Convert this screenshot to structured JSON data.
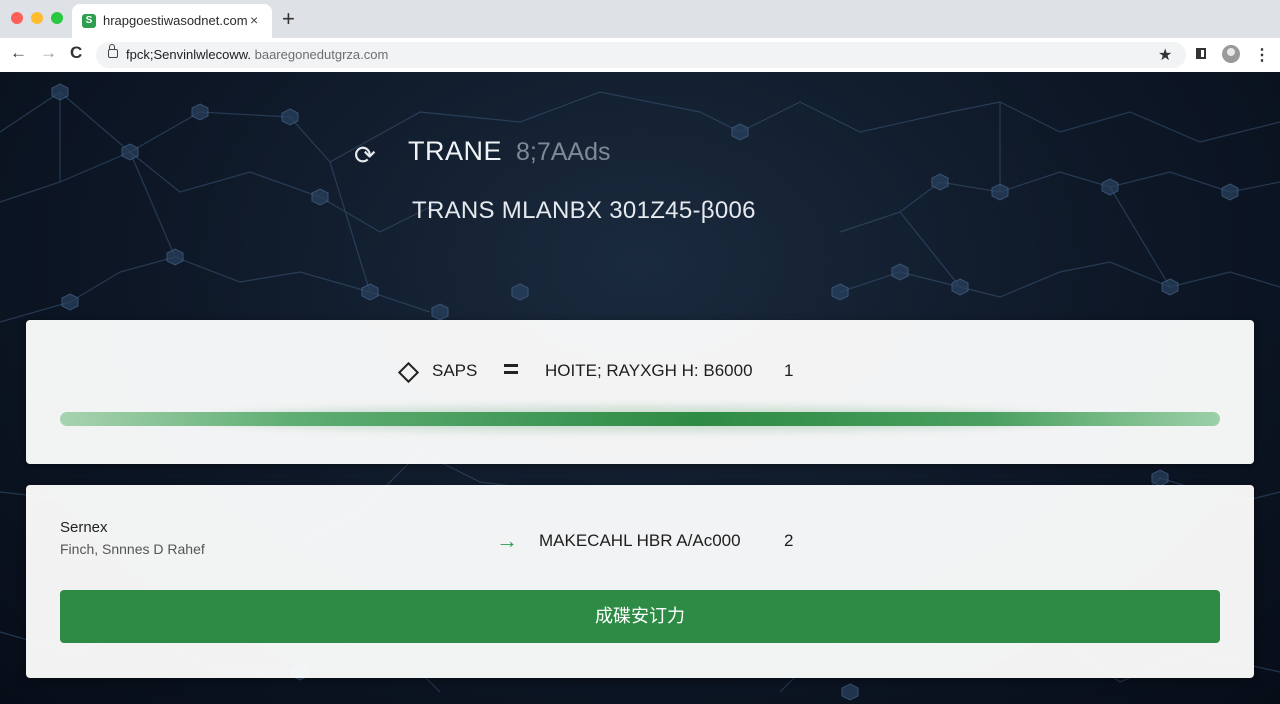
{
  "browser": {
    "tab_title": "hrapgoestiwasodnet.com",
    "tab_close": "×",
    "new_tab": "+",
    "url_host": "fpck;Senvinlwlecoww.",
    "url_rest": " baaregonedutgrza.com",
    "back": "←",
    "forward": "→",
    "reload": "C",
    "bookmark": "★",
    "menu": "⋮"
  },
  "hero": {
    "title": "TRANE",
    "title_faded": "8;7AAds",
    "subtitle": "TRANS MLANBX  301Z45-β006"
  },
  "card1": {
    "label_left": "SAPS",
    "label_right": "HOITE; RAYXGH H: B6000",
    "count": "1",
    "progress_fraction": 0.93,
    "progress_color": "#2e8b45"
  },
  "card2": {
    "side_title": "Sernex",
    "side_subtitle": "Finch, Snnnes D Rahef",
    "label": "MAKECAHL HBR A/Ac000",
    "count": "2",
    "button_label": "成碟安订力",
    "button_color": "#2e8b45"
  },
  "colors": {
    "accent": "#2e9e4f",
    "background": "#0d1726"
  }
}
